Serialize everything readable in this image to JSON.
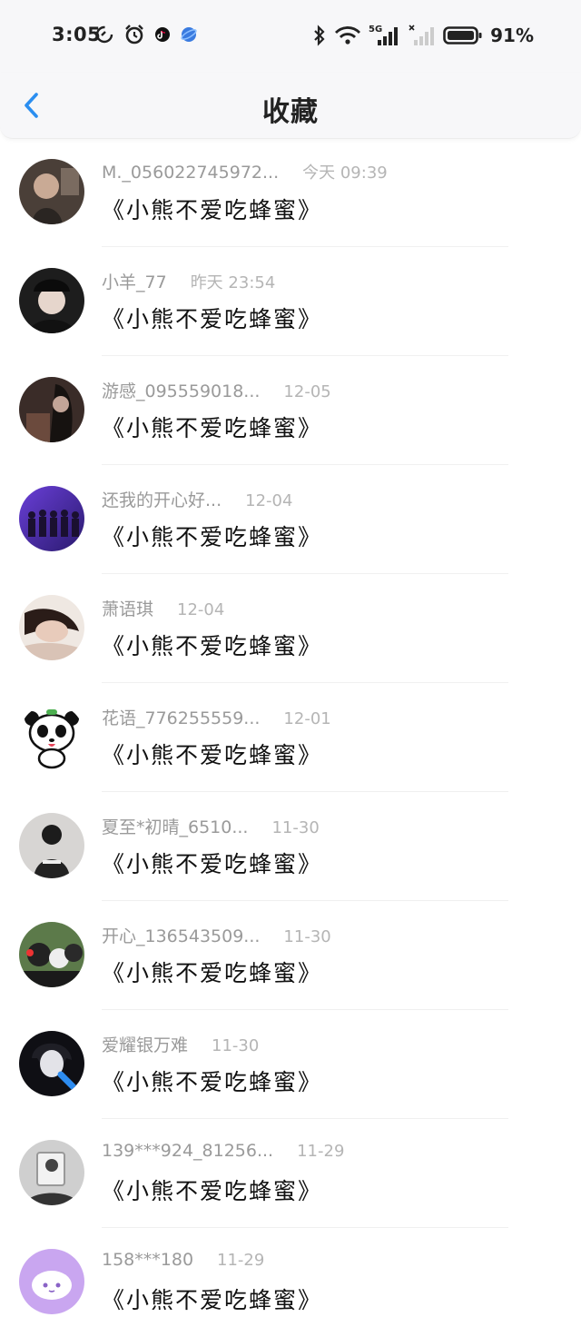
{
  "status_bar": {
    "time": "3:05",
    "battery_text": "91%",
    "network_label": "5G"
  },
  "header": {
    "title": "收藏"
  },
  "favorites": [
    {
      "user": "M._056022745972...",
      "time": "今天 09:39",
      "title": "《小熊不爱吃蜂蜜》",
      "avatar": "a1"
    },
    {
      "user": "小羊_77",
      "time": "昨天 23:54",
      "title": "《小熊不爱吃蜂蜜》",
      "avatar": "a2"
    },
    {
      "user": "游感_095559018...",
      "time": "12-05",
      "title": "《小熊不爱吃蜂蜜》",
      "avatar": "a3"
    },
    {
      "user": "还我的开心好...",
      "time": "12-04",
      "title": "《小熊不爱吃蜂蜜》",
      "avatar": "a4"
    },
    {
      "user": "萧语琪",
      "time": "12-04",
      "title": "《小熊不爱吃蜂蜜》",
      "avatar": "a5"
    },
    {
      "user": "花语_776255559...",
      "time": "12-01",
      "title": "《小熊不爱吃蜂蜜》",
      "avatar": "panda"
    },
    {
      "user": "夏至*初晴_6510...",
      "time": "11-30",
      "title": "《小熊不爱吃蜂蜜》",
      "avatar": "a7"
    },
    {
      "user": "开心_136543509...",
      "time": "11-30",
      "title": "《小熊不爱吃蜂蜜》",
      "avatar": "a8"
    },
    {
      "user": "爱耀银万难",
      "time": "11-30",
      "title": "《小熊不爱吃蜂蜜》",
      "avatar": "a9"
    },
    {
      "user": "139***924_81256...",
      "time": "11-29",
      "title": "《小熊不爱吃蜂蜜》",
      "avatar": "a10"
    },
    {
      "user": "158***180",
      "time": "11-29",
      "title": "《小熊不爱吃蜂蜜》",
      "avatar": "a11"
    }
  ],
  "colors": {
    "accent": "#2b8ef0",
    "meta_text": "#9a9a9a",
    "time_text": "#b5b5b5"
  }
}
